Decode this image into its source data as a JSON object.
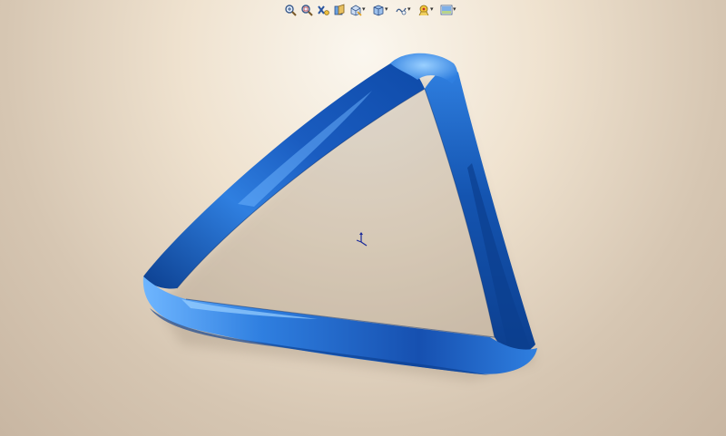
{
  "toolbar": {
    "buttons": [
      {
        "name": "zoom-to-fit-icon",
        "has_dropdown": false
      },
      {
        "name": "zoom-to-area-icon",
        "has_dropdown": false
      },
      {
        "name": "previous-view-icon",
        "has_dropdown": false
      },
      {
        "name": "section-view-icon",
        "has_dropdown": false
      },
      {
        "name": "view-orientation-icon",
        "has_dropdown": true
      },
      {
        "name": "display-style-icon",
        "has_dropdown": true
      },
      {
        "name": "hide-show-items-icon",
        "has_dropdown": true
      },
      {
        "name": "edit-appearance-icon",
        "has_dropdown": true
      },
      {
        "name": "apply-scene-icon",
        "has_dropdown": true
      }
    ]
  },
  "model": {
    "color_main": "#2f7fe0",
    "color_light": "#6fb6ff",
    "color_dark": "#0c3f8f"
  },
  "colors": {
    "background_top": "#fbf7ef",
    "background_bottom": "#c8b6a2"
  }
}
